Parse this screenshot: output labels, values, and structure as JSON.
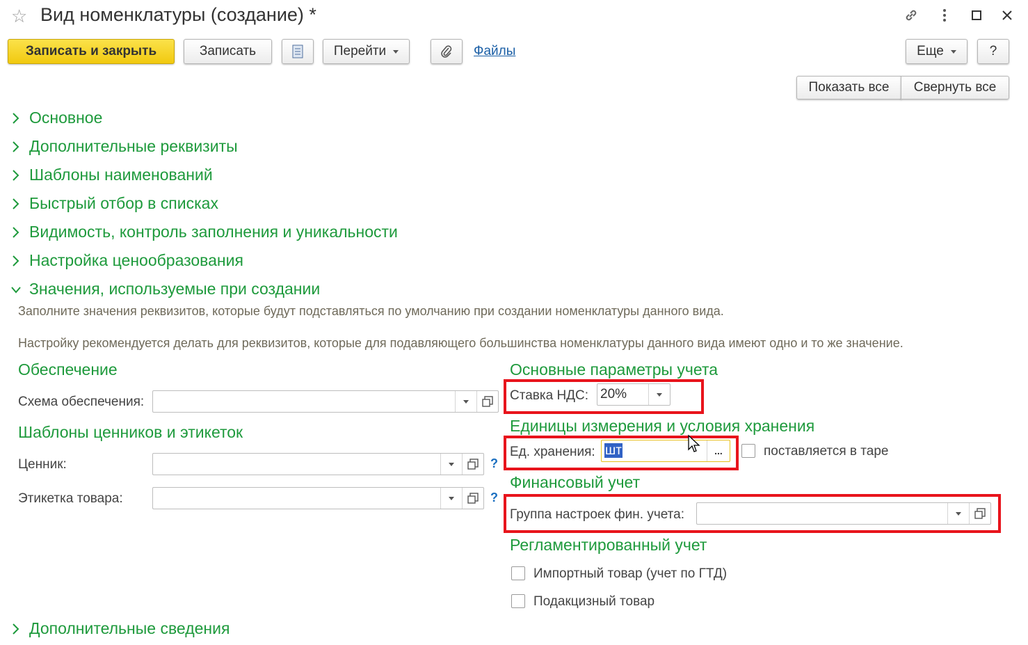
{
  "window": {
    "title": "Вид номенклатуры (создание) *",
    "icons": [
      "star-icon",
      "link-icon",
      "more-vertical-icon",
      "maximize-icon",
      "close-icon"
    ]
  },
  "toolbar": {
    "save_close": "Записать и закрыть",
    "save": "Записать",
    "goto": "Перейти",
    "files": "Файлы",
    "more": "Еще",
    "help": "?"
  },
  "expand_controls": {
    "show_all": "Показать все",
    "collapse_all": "Свернуть все"
  },
  "sections": [
    {
      "label": "Основное",
      "expanded": false
    },
    {
      "label": "Дополнительные реквизиты",
      "expanded": false
    },
    {
      "label": "Шаблоны наименований",
      "expanded": false
    },
    {
      "label": "Быстрый отбор в списках",
      "expanded": false
    },
    {
      "label": "Видимость, контроль заполнения и уникальности",
      "expanded": false
    },
    {
      "label": "Настройка ценообразования",
      "expanded": false
    },
    {
      "label": "Значения, используемые при создании",
      "expanded": true
    },
    {
      "label": "Дополнительные сведения",
      "expanded": false
    }
  ],
  "hints": {
    "line1": "Заполните значения реквизитов, которые будут подставляться по умолчанию при создании номенклатуры данного вида.",
    "line2": "Настройку рекомендуется делать для реквизитов, которые для подавляющего большинства номенклатуры данного вида имеют одно и то же значение."
  },
  "left": {
    "provision_title": "Обеспечение",
    "provision_scheme_label": "Схема обеспечения:",
    "provision_scheme_value": "",
    "templates_title": "Шаблоны ценников и этикеток",
    "price_tag_label": "Ценник:",
    "price_tag_value": "",
    "product_label_label": "Этикетка товара:",
    "product_label_value": "",
    "help_mark": "?"
  },
  "right": {
    "accounting_title": "Основные параметры учета",
    "vat_label": "Ставка НДС:",
    "vat_value": "20%",
    "units_title": "Единицы измерения и условия хранения",
    "storage_unit_label": "Ед. хранения:",
    "storage_unit_value": "шт",
    "storage_unit_btn": "...",
    "in_container_label": "поставляется в таре",
    "in_container_checked": false,
    "finance_title": "Финансовый учет",
    "fin_group_label": "Группа настроек фин. учета:",
    "fin_group_value": "",
    "regulated_title": "Регламентированный учет",
    "import_label": "Импортный товар (учет по ГТД)",
    "import_checked": false,
    "excise_label": "Подакцизный товар",
    "excise_checked": false
  },
  "colors": {
    "section_green": "#1e9a3c",
    "primary_yellow": "#f5d327",
    "highlight_red": "#e8141c",
    "link_blue": "#1b5fa6"
  }
}
